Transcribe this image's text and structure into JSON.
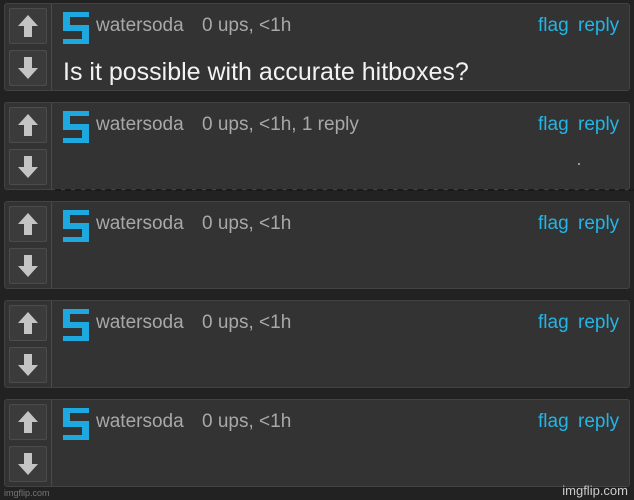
{
  "comments": [
    {
      "username": "watersoda",
      "meta": "0 ups, <1h",
      "flag": "flag",
      "reply": "reply",
      "text": "Is it possible with accurate hitboxes?"
    },
    {
      "username": "watersoda",
      "meta": "0 ups, <1h, 1 reply",
      "flag": "flag",
      "reply": "reply",
      "text": ""
    },
    {
      "username": "watersoda",
      "meta": "0 ups, <1h",
      "flag": "flag",
      "reply": "reply",
      "text": ""
    },
    {
      "username": "watersoda",
      "meta": "0 ups, <1h",
      "flag": "flag",
      "reply": "reply",
      "text": ""
    },
    {
      "username": "watersoda",
      "meta": "0 ups, <1h",
      "flag": "flag",
      "reply": "reply",
      "text": ""
    }
  ],
  "icons": {
    "upvote": "arrow-up-icon",
    "downvote": "arrow-down-icon",
    "avatar": "watersoda-avatar-icon"
  },
  "colors": {
    "background": "#222222",
    "card": "#333333",
    "link": "#22b5e6",
    "meta": "#a8a8a8",
    "text": "#f2f2f2"
  },
  "watermark": {
    "left": "imgflip.com",
    "right": "imgflip.com"
  }
}
